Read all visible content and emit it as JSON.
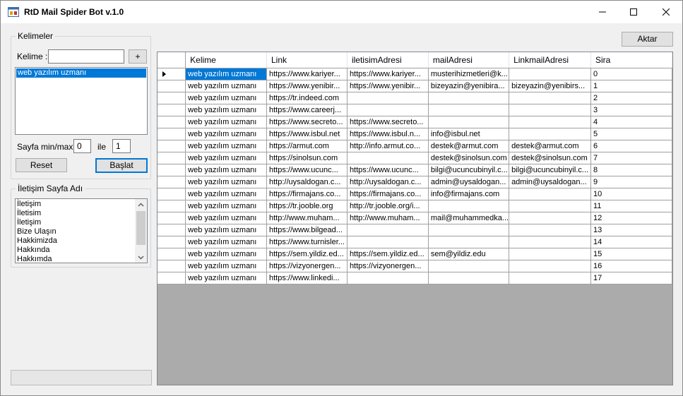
{
  "window": {
    "title": "RtD Mail Spider Bot v.1.0"
  },
  "kelimeler": {
    "legend": "Kelimeler",
    "kelime_label": "Kelime :",
    "kelime_value": "",
    "add_label": "+",
    "list": [
      "web yazılım uzmanı"
    ],
    "sayfa_label": "Sayfa min/max",
    "min_value": "0",
    "ile_label": "ile",
    "max_value": "1",
    "reset_label": "Reset",
    "baslat_label": "Başlat"
  },
  "iletisim": {
    "legend": "İletişim Sayfa Adı",
    "items": [
      "İletişim",
      "İletisim",
      "İletişim",
      "Bize Ulaşın",
      "Hakkimizda",
      "Hakkında",
      "Hakkımda"
    ]
  },
  "aktar_label": "Aktar",
  "grid": {
    "columns": [
      "Kelime",
      "Link",
      "iletisimAdresi",
      "mailAdresi",
      "LinkmailAdresi",
      "Sira"
    ],
    "rows": [
      [
        "web yazılım uzmanı",
        "https://www.kariyer...",
        "https://www.kariyer...",
        "musterihizmetleri@k...",
        "",
        "0"
      ],
      [
        "web yazılım uzmanı",
        "https://www.yenibir...",
        "https://www.yenibir...",
        "bizeyazin@yenibira...",
        "bizeyazin@yenibirs...",
        "1"
      ],
      [
        "web yazılım uzmanı",
        "https://tr.indeed.com",
        "",
        "",
        "",
        "2"
      ],
      [
        "web yazılım uzmanı",
        "https://www.careerj...",
        "",
        "",
        "",
        "3"
      ],
      [
        "web yazılım uzmanı",
        "https://www.secreto...",
        "https://www.secreto...",
        "",
        "",
        "4"
      ],
      [
        "web yazılım uzmanı",
        "https://www.isbul.net",
        "https://www.isbul.n...",
        "info@isbul.net",
        "",
        "5"
      ],
      [
        "web yazılım uzmanı",
        "https://armut.com",
        "http://info.armut.co...",
        "destek@armut.com",
        "destek@armut.com",
        "6"
      ],
      [
        "web yazılım uzmanı",
        "https://sinolsun.com",
        "",
        "destek@sinolsun.com",
        "destek@sinolsun.com",
        "7"
      ],
      [
        "web yazılım uzmanı",
        "https://www.ucunc...",
        "https://www.ucunc...",
        "bilgi@ucuncubinyil.c...",
        "bilgi@ucuncubinyil.c...",
        "8"
      ],
      [
        "web yazılım uzmanı",
        "http://uysaldogan.c...",
        "http://uysaldogan.c...",
        "admin@uysaldogan...",
        "admin@uysaldogan...",
        "9"
      ],
      [
        "web yazılım uzmanı",
        "https://firmajans.co...",
        "https://firmajans.co...",
        "info@firmajans.com",
        "",
        "10"
      ],
      [
        "web yazılım uzmanı",
        "https://tr.jooble.org",
        "http://tr.jooble.org/i...",
        "",
        "",
        "11"
      ],
      [
        "web yazılım uzmanı",
        "http://www.muham...",
        "http://www.muham...",
        "mail@muhammedka...",
        "",
        "12"
      ],
      [
        "web yazılım uzmanı",
        "https://www.bilgead...",
        "",
        "",
        "",
        "13"
      ],
      [
        "web yazılım uzmanı",
        "https://www.turnisler...",
        "",
        "",
        "",
        "14"
      ],
      [
        "web yazılım uzmanı",
        "https://sem.yildiz.ed...",
        "https://sem.yildiz.ed...",
        "sem@yildiz.edu",
        "",
        "15"
      ],
      [
        "web yazılım uzmanı",
        "https://vizyonergen...",
        "https://vizyonergen...",
        "",
        "",
        "16"
      ],
      [
        "web yazılım uzmanı",
        "https://www.linkedi...",
        "",
        "",
        "",
        "17"
      ]
    ]
  },
  "icons": {
    "app": "app-window-icon",
    "row_selector": "row-pointer-icon"
  },
  "colors": {
    "selection": "#0078d7",
    "grid_empty": "#ababab"
  }
}
